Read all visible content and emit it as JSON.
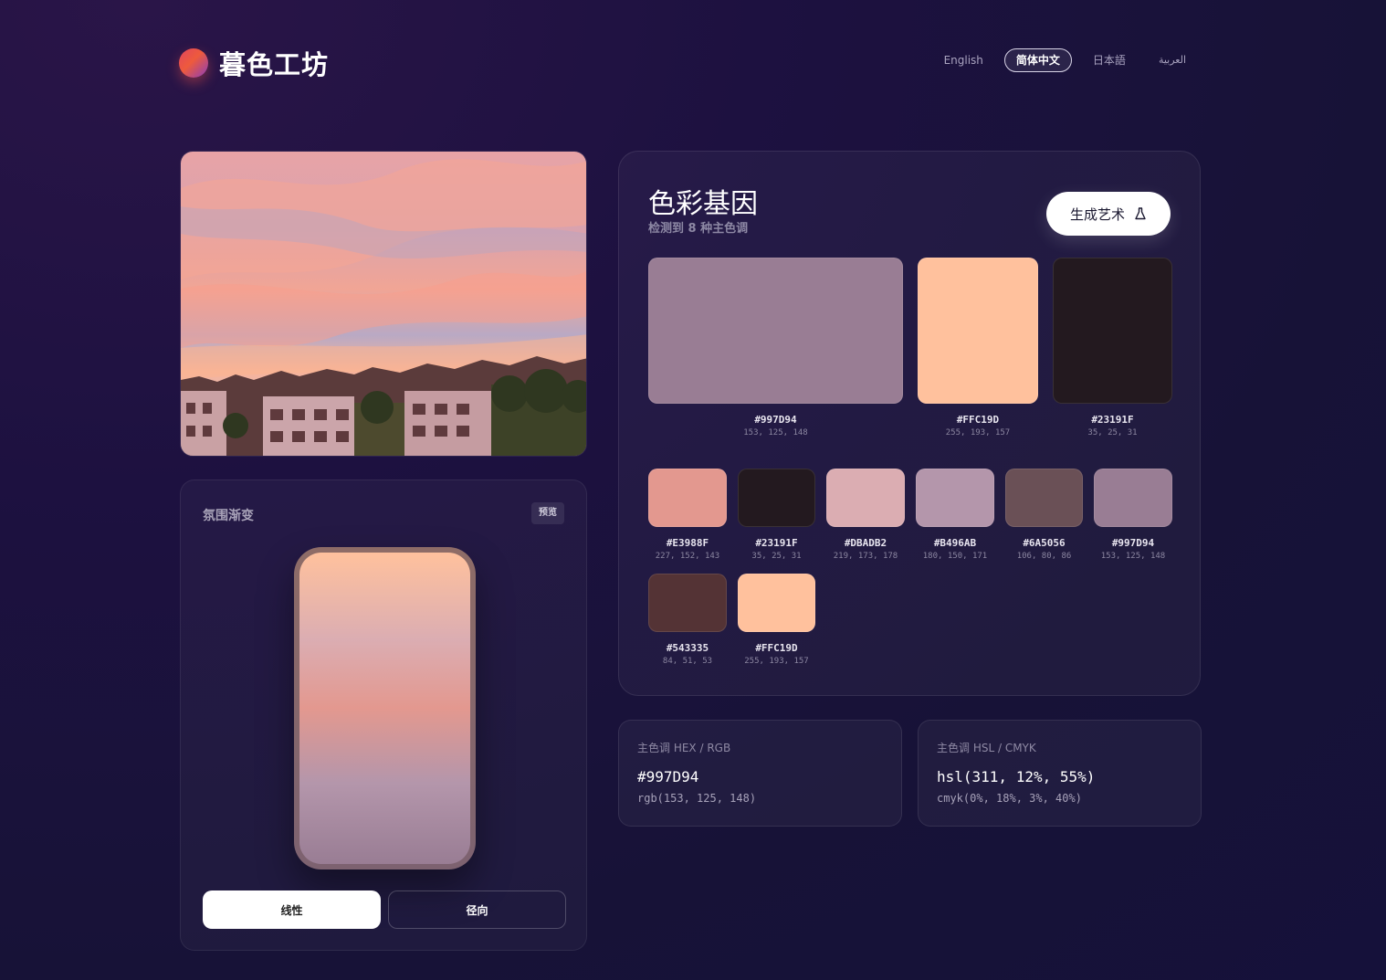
{
  "header": {
    "brand": "暮色工坊",
    "languages": [
      {
        "label": "English",
        "active": false
      },
      {
        "label": "简体中文",
        "active": true
      },
      {
        "label": "日本語",
        "active": false
      },
      {
        "label": "العربية",
        "active": false
      }
    ]
  },
  "gradient_panel": {
    "title": "氛围渐变",
    "badge": "预览",
    "buttons": {
      "linear": "线性",
      "radial": "径向"
    },
    "stops": [
      "#FFC19D",
      "#DBADB2",
      "#E3988F",
      "#B496AB",
      "#997D94"
    ]
  },
  "palette": {
    "title": "色彩基因",
    "subtitle": "检测到 8 种主色调",
    "generate_label": "生成艺术",
    "primary": [
      {
        "hex": "#997D94",
        "rgb": "153, 125, 148"
      },
      {
        "hex": "#FFC19D",
        "rgb": "255, 193, 157"
      },
      {
        "hex": "#23191F",
        "rgb": "35, 25, 31"
      }
    ],
    "swatches": [
      {
        "hex": "#E3988F",
        "rgb": "227, 152, 143"
      },
      {
        "hex": "#23191F",
        "rgb": "35, 25, 31"
      },
      {
        "hex": "#DBADB2",
        "rgb": "219, 173, 178"
      },
      {
        "hex": "#B496AB",
        "rgb": "180, 150, 171"
      },
      {
        "hex": "#6A5056",
        "rgb": "106, 80, 86"
      },
      {
        "hex": "#997D94",
        "rgb": "153, 125, 148"
      },
      {
        "hex": "#543335",
        "rgb": "84, 51, 53"
      },
      {
        "hex": "#FFC19D",
        "rgb": "255, 193, 157"
      }
    ]
  },
  "info": {
    "hex_rgb": {
      "label": "主色调 HEX / RGB",
      "main": "#997D94",
      "sub": "rgb(153, 125, 148)"
    },
    "hsl_cmyk": {
      "label": "主色调 HSL / CMYK",
      "main": "hsl(311, 12%, 55%)",
      "sub": "cmyk(0%, 18%, 3%, 40%)"
    }
  }
}
